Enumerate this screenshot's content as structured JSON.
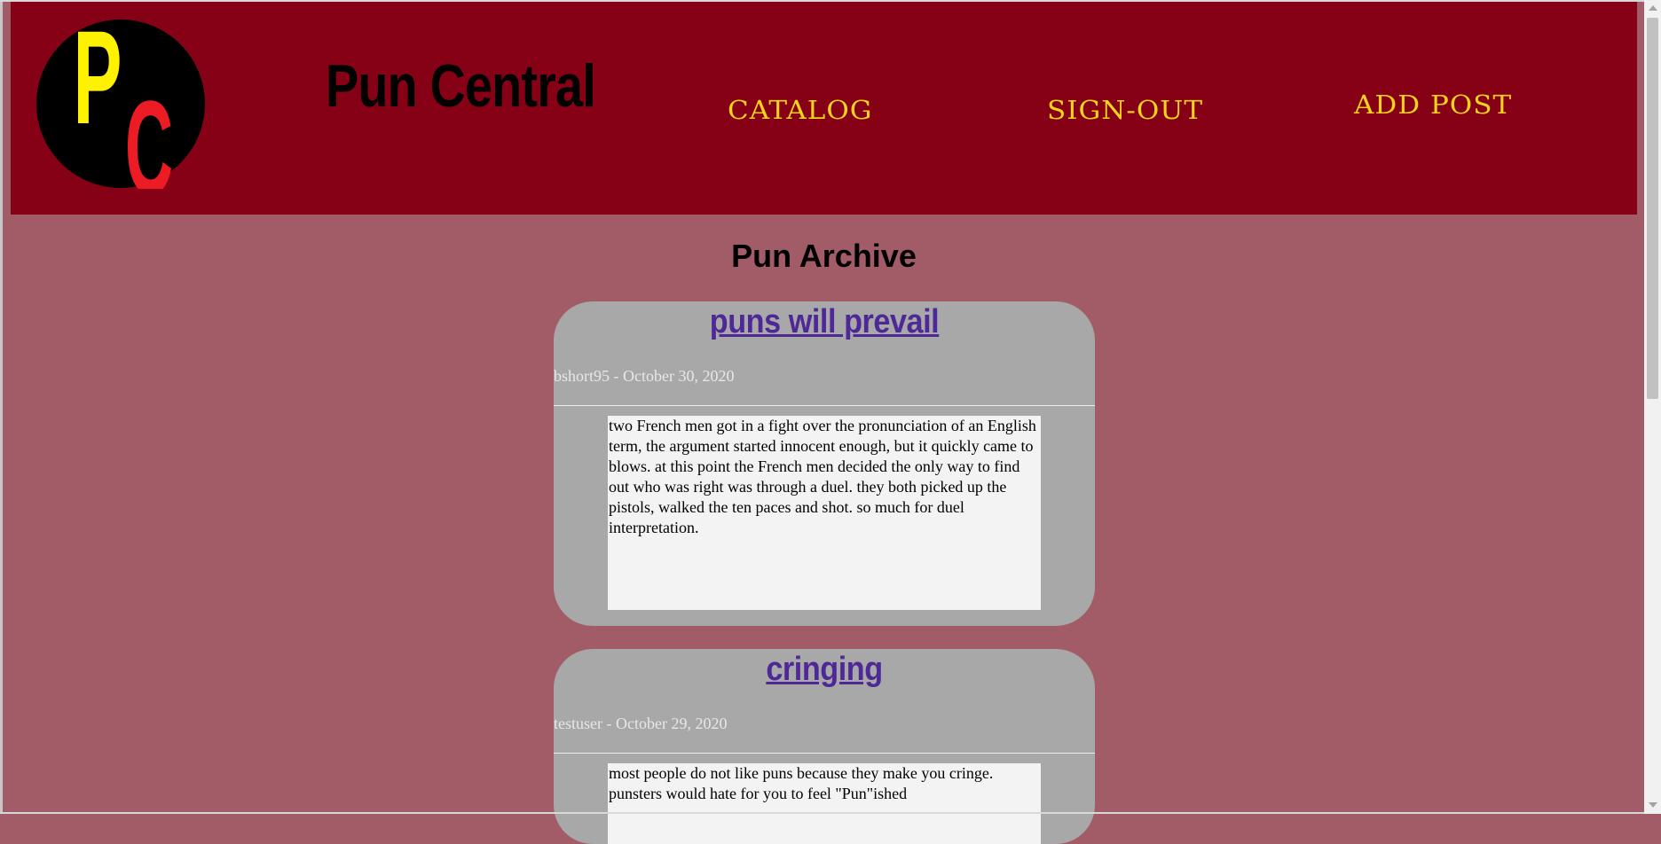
{
  "site": {
    "logo_letters": [
      "P",
      "C"
    ],
    "title": "Pun Central"
  },
  "nav": {
    "catalog": "Catalog",
    "sign_out": "Sign-Out",
    "add_post": "Add Post"
  },
  "page": {
    "heading": "Pun Archive"
  },
  "posts": [
    {
      "title": "puns will prevail",
      "meta": "bshort95 - October 30, 2020",
      "body": "two French men got in a fight over the pronunciation of an English term, the argument started innocent enough, but it quickly came to blows. at this point the French men decided the only way to find out who was right was through a duel. they both picked up the pistols, walked the ten paces and shot. so much for duel interpretation."
    },
    {
      "title": "cringing",
      "meta": "testuser - October 29, 2020",
      "body": "most people do not like puns because they make you cringe. punsters would hate for you to feel \"Pun\"ished"
    }
  ],
  "colors": {
    "header_bg": "#860016",
    "page_bg": "#a25c67",
    "nav_text": "#f2d31b",
    "logo_p": "#fff200",
    "logo_c": "#ed1c24",
    "post_bg": "#a8a8a8",
    "post_link": "#4f2898"
  }
}
